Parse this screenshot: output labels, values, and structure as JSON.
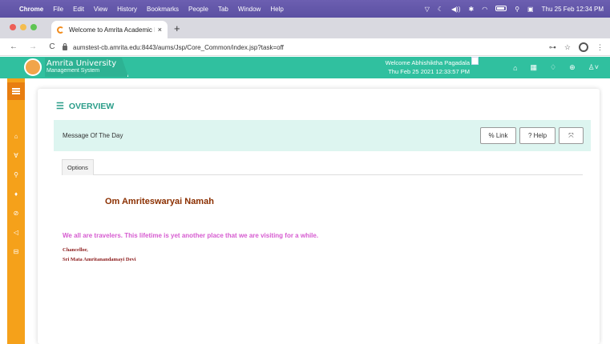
{
  "os_menubar": {
    "apple": "",
    "items": [
      "Chrome",
      "File",
      "Edit",
      "View",
      "History",
      "Bookmarks",
      "People",
      "Tab",
      "Window",
      "Help"
    ],
    "clock": "Thu 25 Feb  12:34 PM"
  },
  "browser": {
    "tab_title": "Welcome to Amrita Academic I",
    "tab_close": "×",
    "new_tab": "+",
    "back": "←",
    "forward": "→",
    "reload": "C",
    "url": "aumstest-cb.amrita.edu:8443/aums/Jsp/Core_Common/index.jsp?task=off",
    "key_icon": "⊶",
    "star_icon": "☆",
    "menu_icon": "⋮"
  },
  "app": {
    "logo_line1": "Amrita University",
    "logo_line2": "Management System",
    "welcome_line1": "Welcome Abhishiktha Pagadala",
    "welcome_line2": "Thu Feb 25 2021 12:33:57 PM",
    "header_icons": [
      "⌂",
      "▦",
      "♢",
      "⊕",
      "♙˅"
    ]
  },
  "sidebar": {
    "icons": [
      "⌂",
      "∀",
      "⚲",
      "♦",
      "⊘",
      "◁",
      "⊟"
    ]
  },
  "overview": {
    "icon": "☰",
    "title": "OVERVIEW"
  },
  "message_bar": {
    "title": "Message Of The Day",
    "link_label": "% Link",
    "help_label": "? Help",
    "expand_label": "⤧"
  },
  "tabs": {
    "options": "Options"
  },
  "message": {
    "greeting": "Om Amriteswaryai Namah",
    "quote": "We all are travelers. This lifetime is yet another place that we are visiting for a while.",
    "signature_line1": "Chancellor,",
    "signature_line2": "Sri Mata Amritanandamayi Devi"
  },
  "colors": {
    "menubar": "#5b50a2",
    "header_teal": "#30c09f",
    "sidebar_orange": "#f5a11a",
    "motd_bg": "#ddf5f0",
    "overview_teal": "#2a9d89",
    "greeting_brown": "#8b2f00",
    "quote_pink": "#d65bd0"
  }
}
